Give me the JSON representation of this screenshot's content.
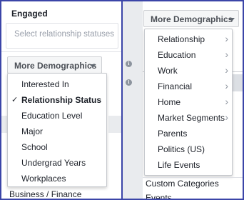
{
  "left": {
    "engaged_label": "Engaged",
    "relationship_placeholder": "Select relationship statuses",
    "more_demographics": "More Demographics",
    "menu_items": [
      {
        "label": "Interested In",
        "selected": false
      },
      {
        "label": "Relationship Status",
        "selected": true
      },
      {
        "label": "Education Level",
        "selected": false
      },
      {
        "label": "Major",
        "selected": false
      },
      {
        "label": "School",
        "selected": false
      },
      {
        "label": "Undergrad Years",
        "selected": false
      },
      {
        "label": "Workplaces",
        "selected": false
      }
    ],
    "check_glyph": "✓",
    "bottom_item": "Business / Finance"
  },
  "info_icon_glyph": "i",
  "right": {
    "more_demographics": "More Demographics",
    "menu_items": [
      {
        "label": "Relationship",
        "has_submenu": true
      },
      {
        "label": "Education",
        "has_submenu": true
      },
      {
        "label": "Work",
        "has_submenu": true
      },
      {
        "label": "Financial",
        "has_submenu": true
      },
      {
        "label": "Home",
        "has_submenu": true
      },
      {
        "label": "Market Segments",
        "has_submenu": true
      },
      {
        "label": "Parents",
        "has_submenu": false
      },
      {
        "label": "Politics (US)",
        "has_submenu": false
      },
      {
        "label": "Life Events",
        "has_submenu": false
      }
    ],
    "chevron_glyph": "›",
    "below_items": [
      "Custom Categories",
      "Events"
    ]
  },
  "colors": {
    "frame_border": "#3b45a8",
    "panel_gray": "#e9ebee",
    "text": "#1d2129",
    "placeholder": "#9aa0ab"
  }
}
